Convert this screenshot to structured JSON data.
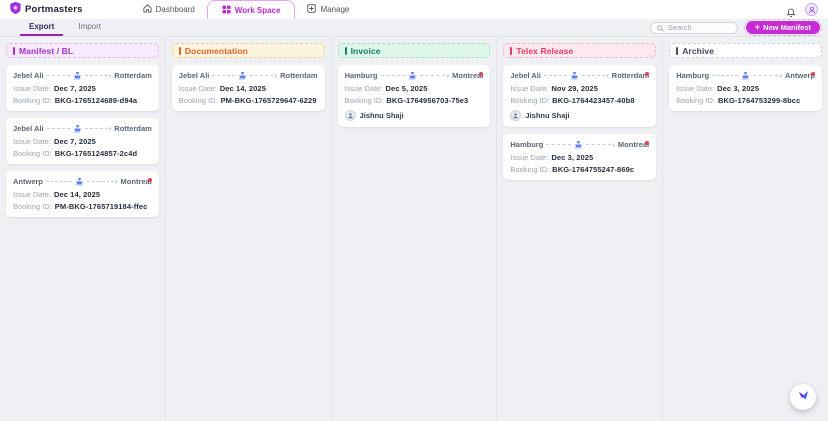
{
  "header": {
    "brand": "Portmasters",
    "nav": [
      {
        "label": "Dashboard",
        "icon": "home-icon",
        "active": false
      },
      {
        "label": "Work Space",
        "icon": "grid-icon",
        "active": true
      },
      {
        "label": "Manage",
        "icon": "apps-icon",
        "active": false
      }
    ]
  },
  "subheader": {
    "tabs": [
      {
        "label": "Export",
        "active": true
      },
      {
        "label": "Import",
        "active": false
      }
    ],
    "search_placeholder": "Search",
    "new_manifest": {
      "label": "New Manifest",
      "plus_glyph": "+"
    }
  },
  "icons": {
    "route_arrow": "›"
  },
  "colors": {
    "brand_accent": "#c026d3",
    "alert": "#e8404f",
    "ship_icon": "#5b7ff2"
  },
  "board": {
    "labels": {
      "issue_date": "Issue Date:",
      "booking_id": "Booking ID:"
    },
    "columns": [
      {
        "title": "Manifest / BL",
        "accent": "#a62fc9",
        "bg": "#f7eafc",
        "border": "#e2b6f2",
        "cards": [
          {
            "origin": "Jebel Ali",
            "destination": "Rotterdam",
            "issue_date": "Dec 7, 2025",
            "booking_id": "BKG-1765124689-d94a",
            "alert": false
          },
          {
            "origin": "Jebel Ali",
            "destination": "Rotterdam",
            "issue_date": "Dec 7, 2025",
            "booking_id": "BKG-1765124857-2c4d",
            "alert": false
          },
          {
            "origin": "Antwerp",
            "destination": "Montreal",
            "issue_date": "Dec 14, 2025",
            "booking_id": "PM-BKG-1765719184-ffec",
            "alert": true
          }
        ]
      },
      {
        "title": "Documentation",
        "accent": "#dd6327",
        "bg": "#fdf4df",
        "border": "#edcf96",
        "cards": [
          {
            "origin": "Jebel Ali",
            "destination": "Rotterdam",
            "issue_date": "Dec 14, 2025",
            "booking_id": "PM-BKG-1765729647-6229",
            "alert": false
          }
        ]
      },
      {
        "title": "Invoice",
        "accent": "#157f5f",
        "bg": "#dcf6ea",
        "border": "#a9dfc8",
        "cards": [
          {
            "origin": "Hamburg",
            "destination": "Montreal",
            "issue_date": "Dec 5, 2025",
            "booking_id": "BKG-1764956703-75e3",
            "alert": true,
            "assignee": "Jishnu Shaji"
          }
        ]
      },
      {
        "title": "Telex Release",
        "accent": "#e73a63",
        "bg": "#fde9ef",
        "border": "#f6b3c6",
        "cards": [
          {
            "origin": "Jebel Ali",
            "destination": "Rotterdam",
            "issue_date": "Nov 29, 2025",
            "booking_id": "BKG-1764423457-40b8",
            "alert": true,
            "assignee": "Jishnu Shaji"
          },
          {
            "origin": "Hamburg",
            "destination": "Montreal",
            "issue_date": "Dec 3, 2025",
            "booking_id": "BKG-1764755247-869c",
            "alert": true
          }
        ]
      },
      {
        "title": "Archive",
        "accent": "#3e4a5b",
        "bg": "#ffffff",
        "border": "#ccd3dc",
        "cards": [
          {
            "origin": "Hamburg",
            "destination": "Antwerp",
            "issue_date": "Dec 3, 2025",
            "booking_id": "BKG-1764753299-8bcc",
            "alert": true
          }
        ]
      }
    ]
  }
}
